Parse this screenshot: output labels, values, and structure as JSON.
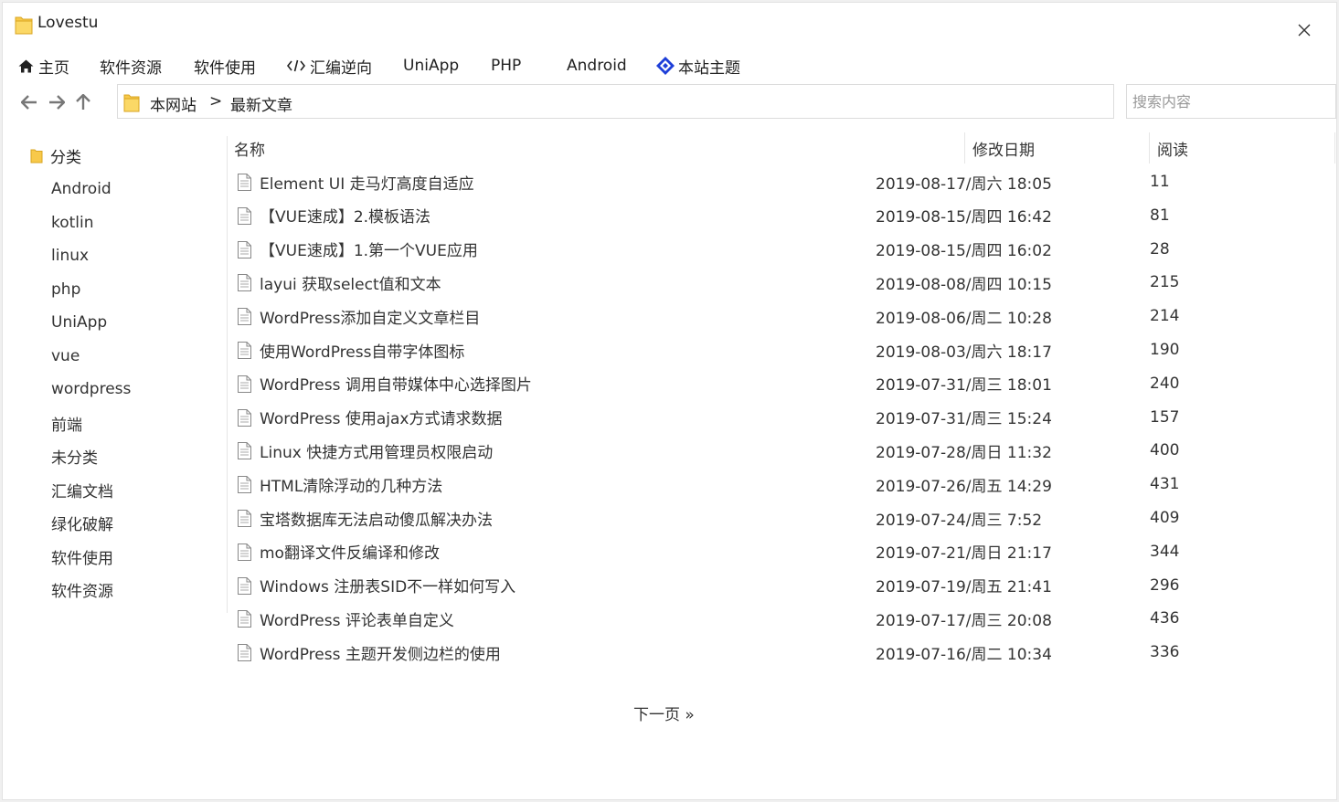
{
  "window": {
    "title": "Lovestu"
  },
  "menu": [
    {
      "label": "主页",
      "icon": "home-icon"
    },
    {
      "label": "软件资源",
      "icon": ""
    },
    {
      "label": "软件使用",
      "icon": ""
    },
    {
      "label": "汇编逆向",
      "icon": "code-icon"
    },
    {
      "label": "UniApp",
      "icon": ""
    },
    {
      "label": "PHP",
      "icon": ""
    },
    {
      "label": "Android",
      "icon": ""
    },
    {
      "label": "本站主题",
      "icon": "diamond-logo-icon"
    }
  ],
  "address": {
    "root": "本网站",
    "separator": ">",
    "current": "最新文章"
  },
  "search": {
    "placeholder": "搜索内容",
    "value": ""
  },
  "sidebar": {
    "header": "分类",
    "items": [
      "Android",
      "kotlin",
      "linux",
      "php",
      "UniApp",
      "vue",
      "wordpress",
      "前端",
      "未分类",
      "汇编文档",
      "绿化破解",
      "软件使用",
      "软件资源"
    ]
  },
  "table": {
    "columns": {
      "name": "名称",
      "date": "修改日期",
      "reads": "阅读"
    },
    "rows": [
      {
        "name": "Element UI 走马灯高度自适应",
        "date": "2019-08-17/周六 18:05",
        "reads": "11"
      },
      {
        "name": "【VUE速成】2.模板语法",
        "date": "2019-08-15/周四 16:42",
        "reads": "81"
      },
      {
        "name": "【VUE速成】1.第一个VUE应用",
        "date": "2019-08-15/周四 16:02",
        "reads": "28"
      },
      {
        "name": "layui 获取select值和文本",
        "date": "2019-08-08/周四 10:15",
        "reads": "215"
      },
      {
        "name": "WordPress添加自定义文章栏目",
        "date": "2019-08-06/周二 10:28",
        "reads": "214"
      },
      {
        "name": "使用WordPress自带字体图标",
        "date": "2019-08-03/周六 18:17",
        "reads": "190"
      },
      {
        "name": "WordPress 调用自带媒体中心选择图片",
        "date": "2019-07-31/周三 18:01",
        "reads": "240"
      },
      {
        "name": "WordPress 使用ajax方式请求数据",
        "date": "2019-07-31/周三 15:24",
        "reads": "157"
      },
      {
        "name": "Linux 快捷方式用管理员权限启动",
        "date": "2019-07-28/周日 11:32",
        "reads": "400"
      },
      {
        "name": "HTML清除浮动的几种方法",
        "date": "2019-07-26/周五 14:29",
        "reads": "431"
      },
      {
        "name": "宝塔数据库无法启动傻瓜解决办法",
        "date": "2019-07-24/周三 7:52",
        "reads": "409"
      },
      {
        "name": "mo翻译文件反编译和修改",
        "date": "2019-07-21/周日 21:17",
        "reads": "344"
      },
      {
        "name": "Windows 注册表SID不一样如何写入",
        "date": "2019-07-19/周五 21:41",
        "reads": "296"
      },
      {
        "name": "WordPress 评论表单自定义",
        "date": "2019-07-17/周三 20:08",
        "reads": "436"
      },
      {
        "name": "WordPress 主题开发侧边栏的使用",
        "date": "2019-07-16/周二 10:34",
        "reads": "336"
      }
    ]
  },
  "pagination": {
    "next": "下一页 »"
  },
  "colors": {
    "folder": "#f8c94a",
    "accent": "#1e3fd8",
    "text": "#222222"
  }
}
